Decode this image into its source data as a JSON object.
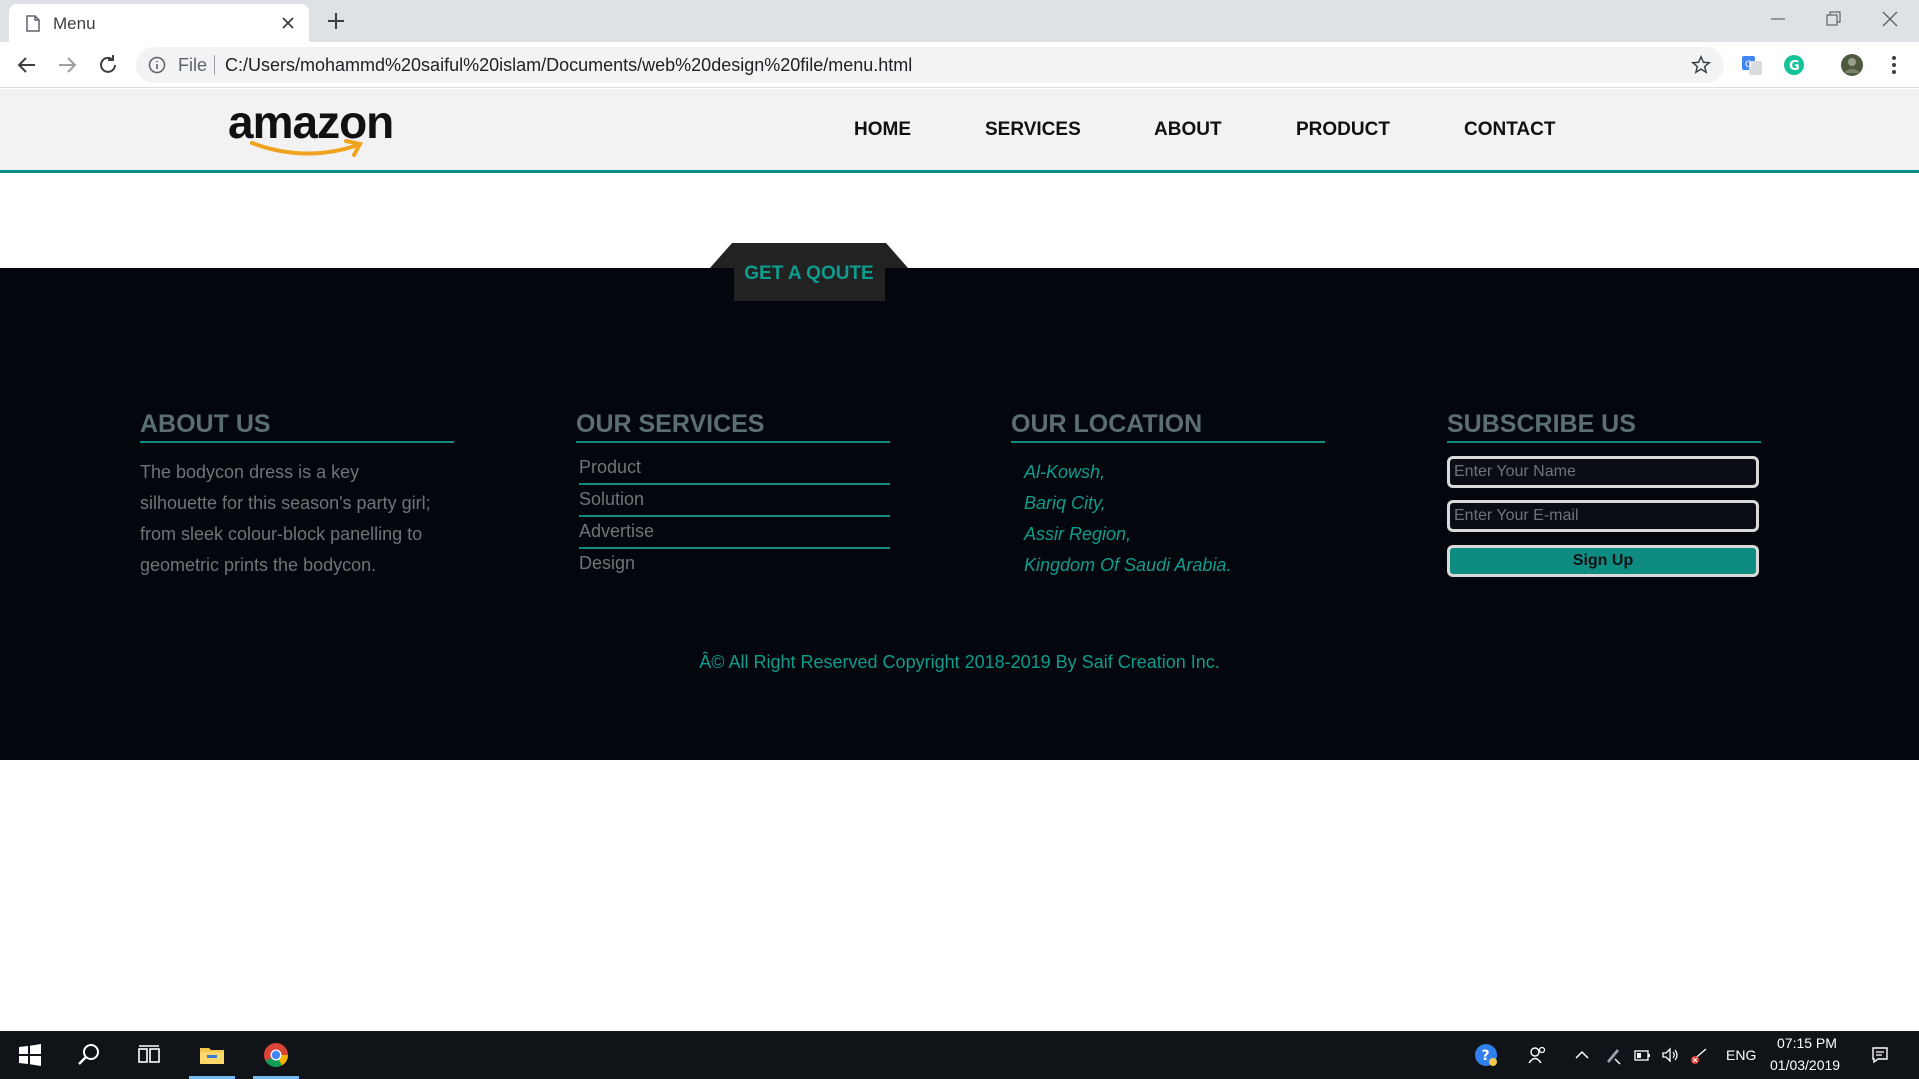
{
  "browser": {
    "tab_title": "Menu",
    "address_prefix": "File",
    "url": "C:/Users/mohammd%20saiful%20islam/Documents/web%20design%20file/menu.html"
  },
  "site": {
    "logo_text": "amazon",
    "nav": [
      "HOME",
      "SERVICES",
      "ABOUT",
      "PRODUCT",
      "CONTACT"
    ],
    "quote_label": "GET A QOUTE"
  },
  "footer": {
    "about": {
      "heading": "ABOUT US",
      "lines": [
        "The bodycon dress is a key",
        "silhouette for this season's party girl;",
        "from sleek colour-block panelling to",
        "geometric prints the bodycon."
      ]
    },
    "services": {
      "heading": "OUR SERVICES",
      "items": [
        "Product",
        "Solution",
        "Advertise",
        "Design"
      ]
    },
    "location": {
      "heading": "OUR LOCATION",
      "lines": [
        "Al-Kowsh,",
        "Bariq City,",
        "Assir Region,",
        "Kingdom Of Saudi Arabia."
      ]
    },
    "subscribe": {
      "heading": "SUBSCRIBE US",
      "name_placeholder": "Enter Your Name",
      "email_placeholder": "Enter Your E-mail",
      "button_label": "Sign Up"
    },
    "copyright": "Â© All Right Reserved Copyright 2018-2019 By Saif Creation Inc."
  },
  "taskbar": {
    "language": "ENG",
    "time": "07:15 PM",
    "date": "01/03/2019"
  },
  "colors": {
    "accent": "#0e8c82",
    "footer_bg": "#03060c",
    "header_bg": "#f2f2f2"
  }
}
